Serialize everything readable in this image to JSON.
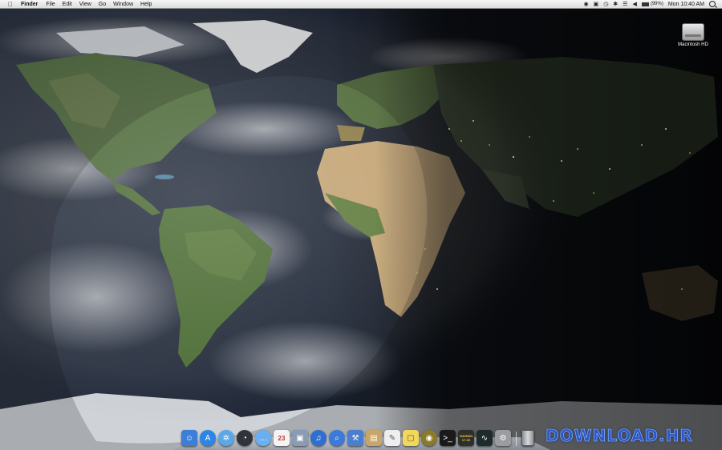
{
  "menubar": {
    "apple_icon": "apple-icon",
    "menus": [
      "Finder",
      "File",
      "Edit",
      "View",
      "Go",
      "Window",
      "Help"
    ],
    "status": {
      "battery_text": "(99%)",
      "battery_level": 0.99,
      "clock": "Mon 10:40 AM"
    }
  },
  "desktop": {
    "disk_label": "Macintosh HD"
  },
  "dock": {
    "items": [
      {
        "name": "finder-icon",
        "color": "#3d7fd6"
      },
      {
        "name": "app-store-icon",
        "color": "#2b86e6"
      },
      {
        "name": "safari-compass-icon",
        "color": "#5aa8e8"
      },
      {
        "name": "dashboard-icon",
        "color": "#30343a"
      },
      {
        "name": "ichat-icon",
        "color": "#6ab0f0"
      },
      {
        "name": "ical-icon",
        "color": "#f4f4f4",
        "text": "23"
      },
      {
        "name": "iphoto-icon",
        "color": "#8a9bb4"
      },
      {
        "name": "itunes-icon",
        "color": "#2e6fd1"
      },
      {
        "name": "spotlight-search-icon",
        "color": "#3b7ad9"
      },
      {
        "name": "xcode-icon",
        "color": "#4a7fd0"
      },
      {
        "name": "preview-icon",
        "color": "#c9a56a"
      },
      {
        "name": "textedit-icon",
        "color": "#eeeeee"
      },
      {
        "name": "stickies-icon",
        "color": "#f2d75a"
      },
      {
        "name": "aperture-icon",
        "color": "#8c7a2a"
      },
      {
        "name": "terminal-icon",
        "color": "#1a1a1a"
      },
      {
        "name": "console-log-icon",
        "color": "#2d2f2a",
        "text": "WARNIN 17:30"
      },
      {
        "name": "activity-monitor-icon",
        "color": "#1e2b2a"
      },
      {
        "name": "system-preferences-icon",
        "color": "#9a9ca0"
      }
    ],
    "trash_icon": "trash-icon"
  },
  "watermark": {
    "text": "DOWNLOAD.HR"
  }
}
